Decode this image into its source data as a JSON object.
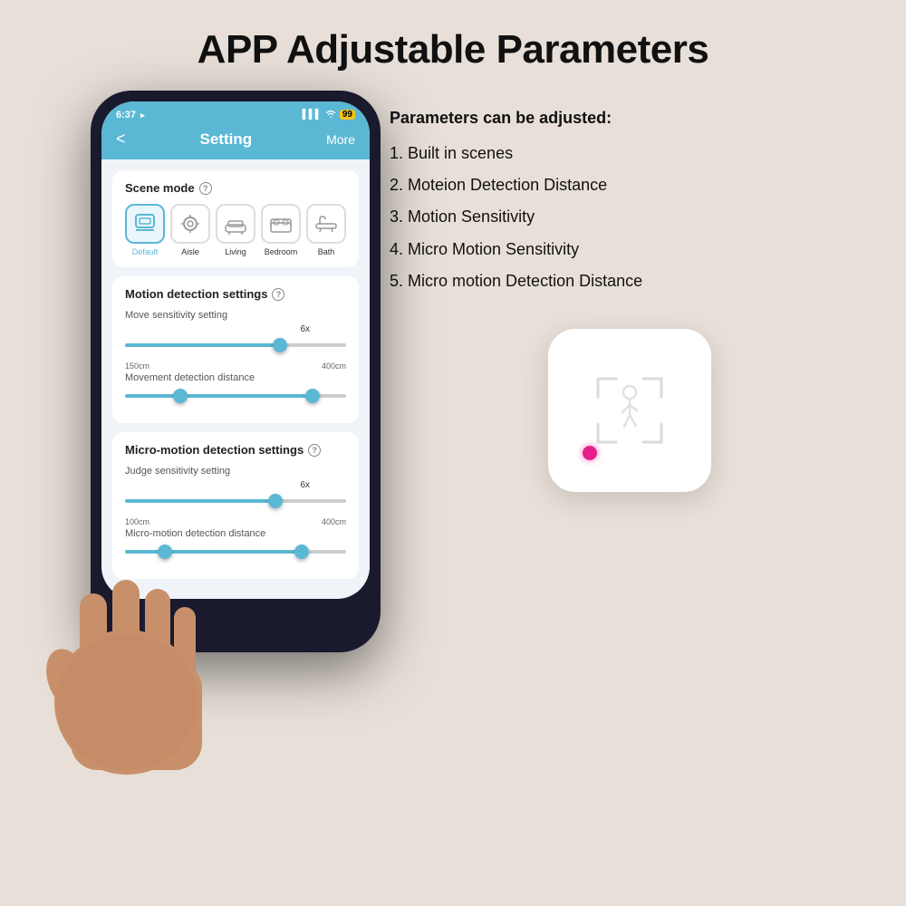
{
  "page": {
    "title": "APP Adjustable Parameters",
    "background_color": "#e8e0d8"
  },
  "phone": {
    "status_bar": {
      "time": "6:37",
      "location_icon": "▲",
      "signal_icon": "▌▌▌",
      "wifi_icon": "wifi",
      "battery": "99"
    },
    "header": {
      "back": "<",
      "title": "Setting",
      "more": "More"
    },
    "scene_mode": {
      "section_title": "Scene mode",
      "items": [
        {
          "label": "Default",
          "icon": "📋",
          "active": true
        },
        {
          "label": "Aisle",
          "icon": "🔍",
          "active": false
        },
        {
          "label": "Living",
          "icon": "🛋",
          "active": false
        },
        {
          "label": "Bedroom",
          "icon": "🏠",
          "active": false
        },
        {
          "label": "Bath",
          "icon": "🚿",
          "active": false
        }
      ]
    },
    "motion_detection": {
      "section_title": "Motion detection settings",
      "move_sensitivity": {
        "label": "Move sensitivity setting",
        "value": "6x",
        "fill_percent": 70
      },
      "movement_distance": {
        "label": "Movement detection distance",
        "min_label": "150cm",
        "max_label": "400cm",
        "thumb1_percent": 25,
        "thumb2_percent": 85
      }
    },
    "micro_motion": {
      "section_title": "Micro-motion detection settings",
      "judge_sensitivity": {
        "label": "Judge sensitivity setting",
        "value": "6x",
        "fill_percent": 68
      },
      "micro_distance": {
        "label": "Micro-motion detection distance",
        "min_label": "100cm",
        "max_label": "400cm",
        "thumb1_percent": 18,
        "thumb2_percent": 80
      }
    }
  },
  "parameters": {
    "intro": "Parameters can be adjusted:",
    "items": [
      {
        "number": "1.",
        "text": "Built in scenes"
      },
      {
        "number": "2.",
        "text": "Moteion Detection Distance"
      },
      {
        "number": "3.",
        "text": "Motion Sensitivity"
      },
      {
        "number": "4.",
        "text": "Micro Motion Sensitivity"
      },
      {
        "number": "5.",
        "text": "Micro motion Detection Distance"
      }
    ]
  },
  "device": {
    "led_color": "#e91e8c",
    "box_color": "#ffffff"
  }
}
